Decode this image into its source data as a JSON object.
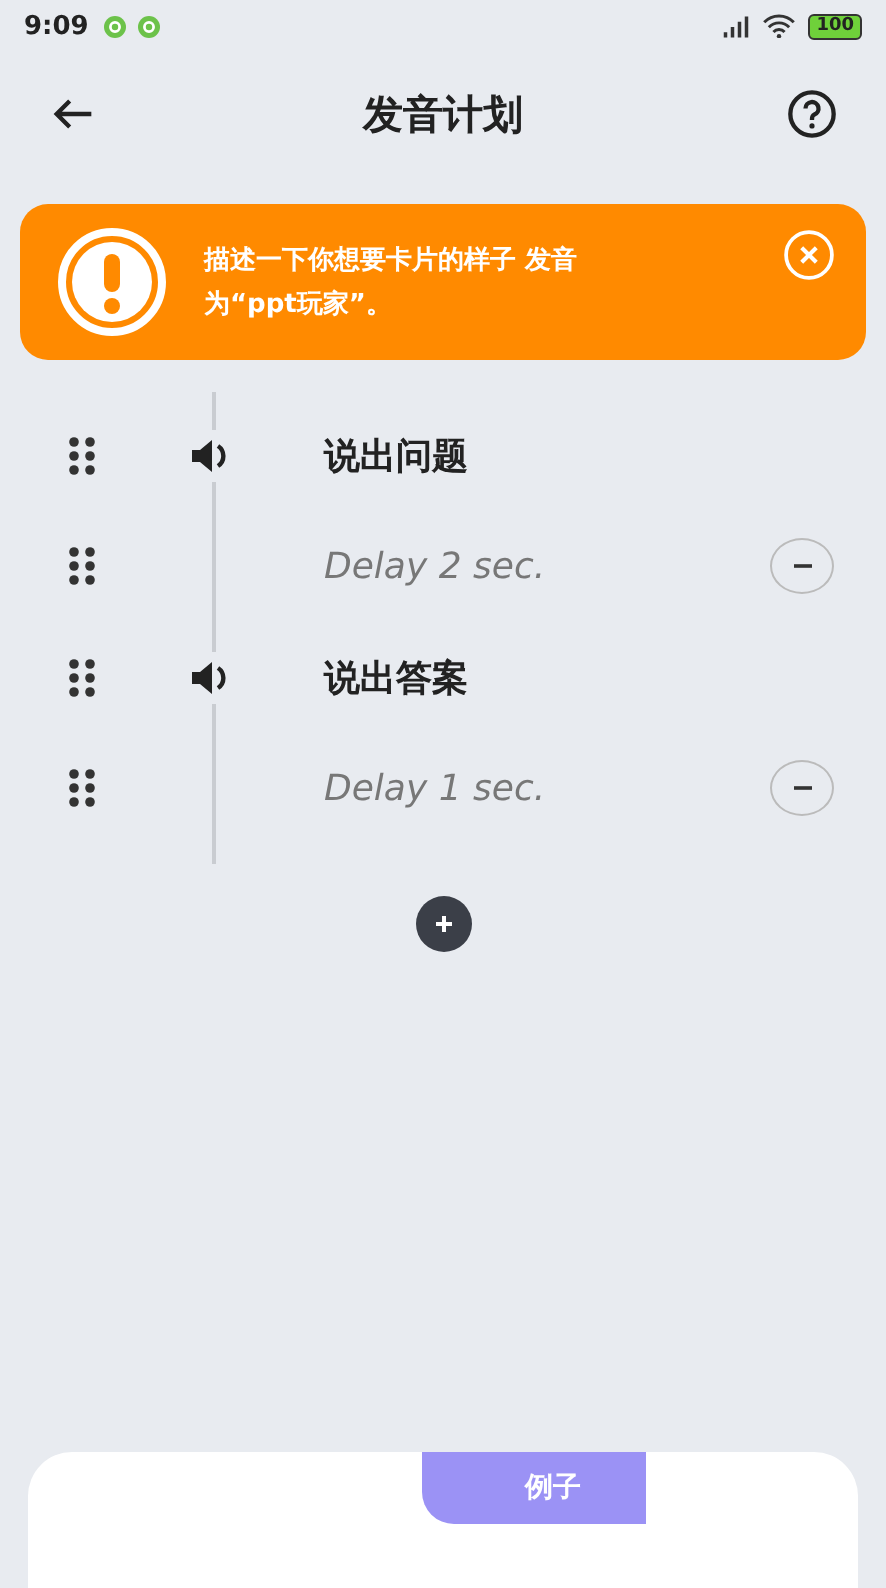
{
  "status_bar": {
    "time": "9:09",
    "battery": "100"
  },
  "header": {
    "title": "发音计划"
  },
  "alert": {
    "text": "描述一下你想要卡片的样子 发音为“ppt玩家”。"
  },
  "steps": [
    {
      "kind": "speak",
      "label": "说出问题"
    },
    {
      "kind": "delay",
      "label": "Delay 2 sec."
    },
    {
      "kind": "speak",
      "label": "说出答案"
    },
    {
      "kind": "delay",
      "label": "Delay 1 sec."
    }
  ],
  "example_card": {
    "tab": "例子"
  }
}
